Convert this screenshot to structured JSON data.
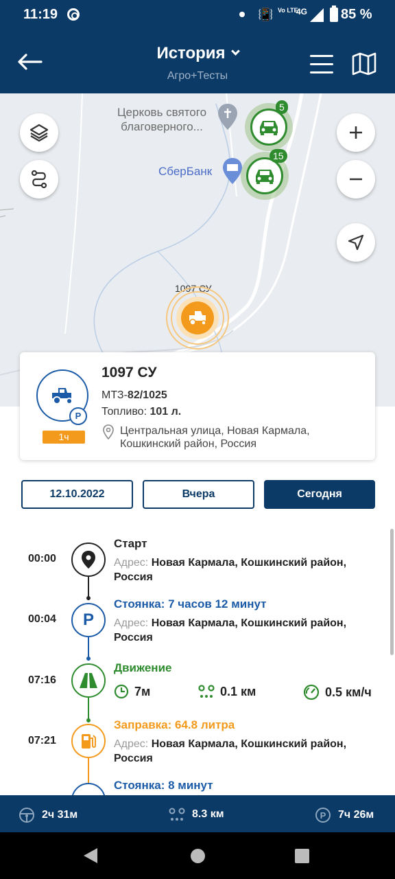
{
  "status_bar": {
    "time": "11:19",
    "volte": "Vo LTE",
    "network": "4G",
    "battery": "85 %"
  },
  "header": {
    "title": "История",
    "subtitle": "Агро+Тесты"
  },
  "map": {
    "church_label": "Церковь святого благоверного...",
    "bank_label": "СберБанк",
    "vehicle_label": "1097 СУ",
    "cluster_1_count": "5",
    "cluster_2_count": "15"
  },
  "vehicle": {
    "name": "1097 СУ",
    "model_prefix": "МТЗ-",
    "model_bold": "82/1025",
    "fuel_prefix": "Топливо: ",
    "fuel_value": "101 л.",
    "address_line1": "Центральная улица, Новая Кармала,",
    "address_line2": "Кошкинский район, Россия",
    "duration_badge": "1ч",
    "parking_badge": "P"
  },
  "date_buttons": {
    "date": "12.10.2022",
    "yesterday": "Вчера",
    "today": "Сегодня"
  },
  "timeline": {
    "address_label": "Адрес: ",
    "events": [
      {
        "time": "00:00",
        "title": "Старт",
        "address_line1": "Новая Кармала, Кошкинский район,",
        "address_line2": "Россия"
      },
      {
        "time": "00:04",
        "title": "Стоянка: 7 часов 12 минут",
        "address_line1": "Новая Кармала, Кошкинский район,",
        "address_line2": "Россия"
      },
      {
        "time": "07:16",
        "title": "Движение",
        "duration": "7м",
        "distance": "0.1 км",
        "speed": "0.5 км/ч"
      },
      {
        "time": "07:21",
        "title": "Заправка: 64.8 литра",
        "address_line1": "Новая Кармала, Кошкинский район,",
        "address_line2": "Россия"
      },
      {
        "title": "Стоянка: 8 минут"
      }
    ]
  },
  "summary": {
    "driving": "2ч 31м",
    "distance": "8.3 км",
    "parking": "7ч 26м"
  },
  "colors": {
    "primary": "#0c3a66",
    "parking_blue": "#1a5aa6",
    "movement_green": "#2e8b2e",
    "fuel_orange": "#f39a1c"
  }
}
